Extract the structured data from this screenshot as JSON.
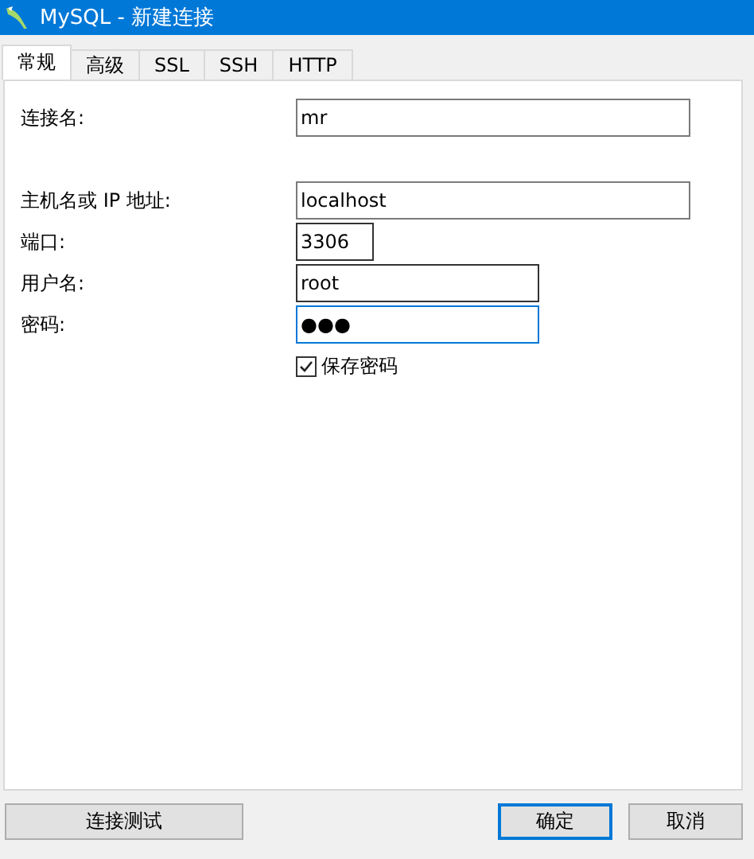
{
  "window": {
    "title": "MySQL - 新建连接"
  },
  "tabs": [
    {
      "label": "常规",
      "selected": true
    },
    {
      "label": "高级",
      "selected": false
    },
    {
      "label": "SSL",
      "selected": false
    },
    {
      "label": "SSH",
      "selected": false
    },
    {
      "label": "HTTP",
      "selected": false
    }
  ],
  "groups": [
    [
      {
        "label": "连接名:",
        "value": "mr",
        "focused": false
      }
    ],
    [
      {
        "label": "主机名或 IP 地址:",
        "value": "localhost",
        "focused": false
      },
      {
        "label": "端口:",
        "value": "3306",
        "focused": false
      },
      {
        "label": "用户名:",
        "value": "root",
        "focused": false
      },
      {
        "label": "密码:",
        "value": "●●●",
        "focused": true
      }
    ]
  ],
  "save_password": {
    "label": "保存密码",
    "checked": true
  },
  "buttons": [
    {
      "label": "连接测试",
      "kind": "test",
      "focused": false
    },
    {
      "label": "确定",
      "kind": "ok",
      "focused": true
    },
    {
      "label": "取消",
      "kind": "cancel",
      "focused": false
    }
  ]
}
